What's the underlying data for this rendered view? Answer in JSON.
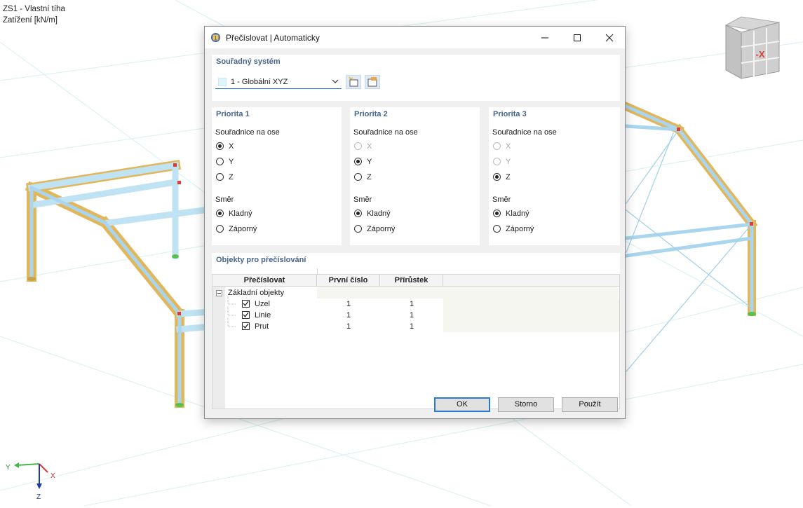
{
  "viewport": {
    "info_line1": "ZS1 - Vlastní tíha",
    "info_line2": "Zatížení [kN/m]",
    "viewcube_face": "-X",
    "axes": {
      "y": "Y",
      "x": "X",
      "z": "Z"
    }
  },
  "dialog": {
    "title": "Přečíslovat | Automaticky",
    "coord_system": {
      "title": "Souřadný systém",
      "selected": "1 - Globální XYZ"
    },
    "priorities": [
      {
        "title": "Priorita 1",
        "axis_label": "Souřadnice na ose",
        "axes": [
          {
            "label": "X",
            "checked": true,
            "enabled": true
          },
          {
            "label": "Y",
            "checked": false,
            "enabled": true
          },
          {
            "label": "Z",
            "checked": false,
            "enabled": true
          }
        ],
        "direction_label": "Směr",
        "directions": [
          {
            "label": "Kladný",
            "checked": true
          },
          {
            "label": "Záporný",
            "checked": false
          }
        ]
      },
      {
        "title": "Priorita 2",
        "axis_label": "Souřadnice na ose",
        "axes": [
          {
            "label": "X",
            "checked": false,
            "enabled": false
          },
          {
            "label": "Y",
            "checked": true,
            "enabled": true
          },
          {
            "label": "Z",
            "checked": false,
            "enabled": true
          }
        ],
        "direction_label": "Směr",
        "directions": [
          {
            "label": "Kladný",
            "checked": true
          },
          {
            "label": "Záporný",
            "checked": false
          }
        ]
      },
      {
        "title": "Priorita 3",
        "axis_label": "Souřadnice na ose",
        "axes": [
          {
            "label": "X",
            "checked": false,
            "enabled": false
          },
          {
            "label": "Y",
            "checked": false,
            "enabled": false
          },
          {
            "label": "Z",
            "checked": true,
            "enabled": true
          }
        ],
        "direction_label": "Směr",
        "directions": [
          {
            "label": "Kladný",
            "checked": true
          },
          {
            "label": "Záporný",
            "checked": false
          }
        ]
      }
    ],
    "objects": {
      "title": "Objekty pro přečíslování",
      "columns": [
        "Přečíslovat",
        "První číslo",
        "Přírůstek"
      ],
      "group": "Základní objekty",
      "rows": [
        {
          "name": "Uzel",
          "checked": true,
          "first": "1",
          "increment": "1"
        },
        {
          "name": "Linie",
          "checked": true,
          "first": "1",
          "increment": "1"
        },
        {
          "name": "Prut",
          "checked": true,
          "first": "1",
          "increment": "1"
        }
      ]
    },
    "buttons": {
      "ok": "OK",
      "cancel": "Storno",
      "apply": "Použít"
    }
  }
}
